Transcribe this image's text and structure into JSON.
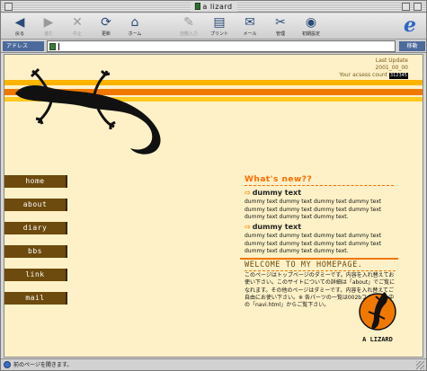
{
  "window": {
    "title": "a lizard"
  },
  "toolbar": {
    "buttons": [
      {
        "label": "戻る",
        "icon": "back-arrow-icon",
        "enabled": true
      },
      {
        "label": "進む",
        "icon": "forward-arrow-icon",
        "enabled": false
      },
      {
        "label": "中止",
        "icon": "stop-x-icon",
        "enabled": false
      },
      {
        "label": "更新",
        "icon": "refresh-icon",
        "enabled": true
      },
      {
        "label": "ホーム",
        "icon": "home-icon",
        "enabled": true
      },
      {
        "label": "自動入力",
        "icon": "autofill-icon",
        "enabled": false
      },
      {
        "label": "プリント",
        "icon": "print-icon",
        "enabled": true
      },
      {
        "label": "メール",
        "icon": "mail-icon",
        "enabled": true
      },
      {
        "label": "管理",
        "icon": "tools-icon",
        "enabled": true
      },
      {
        "label": "初期設定",
        "icon": "preferences-icon",
        "enabled": true
      }
    ]
  },
  "address": {
    "label": "アドレス",
    "value": "",
    "go_label": "移動"
  },
  "page": {
    "last_update_label": "Last Update",
    "last_update_date": "2001_00_00",
    "access_count_label": "Your acsess count",
    "access_count": "312345",
    "nav": [
      "home",
      "about",
      "diary",
      "bbs",
      "link",
      "mail"
    ],
    "whats_new_title": "What's new??",
    "news": [
      {
        "heading": "dummy text",
        "body": "dummy text dummy text dummy text dummy text dummy text dummy text dummy text dummy text dummy text dummy text dummy text."
      },
      {
        "heading": "dummy text",
        "body": "dummy text dummy text dummy text dummy text dummy text dummy text dummy text dummy text dummy text dummy text dummy text."
      }
    ],
    "welcome_title": "WELCOME TO MY HOMEPAGE.",
    "welcome_body": "このページはトップページのダミーです。内容を入れ替えてお使い下さい。このサイトについての詳細は「about」でご覧になれます。その他のページはダミーです。内容を入れ替えてご自由にお使い下さい。※ 各パーツの一覧は002bフォルダの中の「navi.html」からご覧下さい。",
    "badge_text": "A LIZARD"
  },
  "status": {
    "message": "前のページを開きます。"
  },
  "colors": {
    "orange": "#f07800",
    "brown": "#6d4a0d",
    "cream": "#fef1c7",
    "yellow": "#ffb400"
  }
}
